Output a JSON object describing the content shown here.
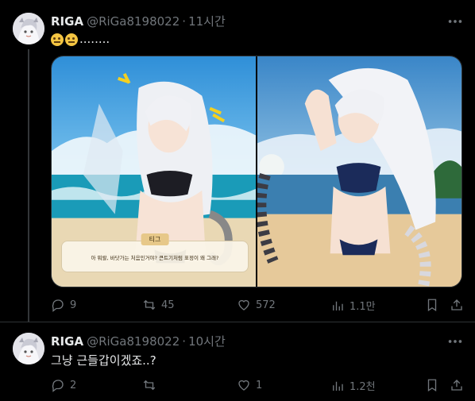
{
  "tweets": [
    {
      "author": "RIGA",
      "handle": "@RiGa8198022",
      "separator": "·",
      "time": "11시간",
      "text_suffix": "........",
      "media": {
        "left_dialog_name": "티그",
        "left_dialog_text": "아 뭐랄, 바닷가는 처음인거야? 큰트기처럼 표정이 왜 그래?"
      },
      "actions": {
        "replies": "9",
        "retweets": "45",
        "likes": "572",
        "views": "1.1만"
      }
    },
    {
      "author": "RIGA",
      "handle": "@RiGa8198022",
      "separator": "·",
      "time": "10시간",
      "text": "그냥 근들갑이겠죠..?",
      "actions": {
        "replies": "2",
        "retweets": "",
        "likes": "1",
        "views": "1.2천"
      }
    }
  ],
  "icons": {
    "reply": "reply-icon",
    "retweet": "retweet-icon",
    "like": "heart-icon",
    "views": "views-icon",
    "bookmark": "bookmark-icon",
    "share": "share-icon",
    "more": "more-icon",
    "emoji": "thinking-face-emoji"
  },
  "colors": {
    "background": "#000000",
    "text": "#e7e9ea",
    "muted": "#71767b",
    "divider": "#2f3336"
  }
}
